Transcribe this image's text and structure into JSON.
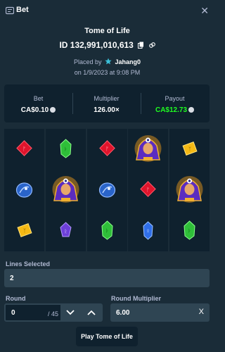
{
  "header": {
    "title": "Bet",
    "close_icon": "close-icon",
    "icon": "ticket-icon"
  },
  "game": {
    "title": "Tome of Life",
    "bet_id": "ID 132,991,010,613",
    "placed_prefix": "Placed by",
    "username": "Jahang0",
    "date": "on 1/9/2023 at 9:08 PM"
  },
  "stats": {
    "bet_label": "Bet",
    "bet_value": "CA$0.10",
    "multiplier_label": "Multiplier",
    "multiplier_value": "126.00×",
    "payout_label": "Payout",
    "payout_value": "CA$12.73"
  },
  "reels": [
    [
      "red-gem",
      "blue-egg",
      "yellow-gem"
    ],
    [
      "green-gem",
      "sphinx",
      "purple-gem"
    ],
    [
      "red-gem",
      "blue-egg",
      "green-gem"
    ],
    [
      "sphinx",
      "red-gem",
      "blue-gem"
    ],
    [
      "yellow-gem",
      "sphinx",
      "green-gem"
    ]
  ],
  "controls": {
    "lines_label": "Lines Selected",
    "lines_value": "2",
    "round_label": "Round",
    "round_value": "0",
    "round_total": "/ 45",
    "round_multiplier_label": "Round Multiplier",
    "round_multiplier_value": "6.00",
    "clear_label": "X",
    "play_label": "Play Tome of Life"
  },
  "colors": {
    "background": "#1a2c38",
    "panel": "#0f212e",
    "field": "#2f4553",
    "payout_green": "#1fff20",
    "muted": "#b1bad3"
  }
}
